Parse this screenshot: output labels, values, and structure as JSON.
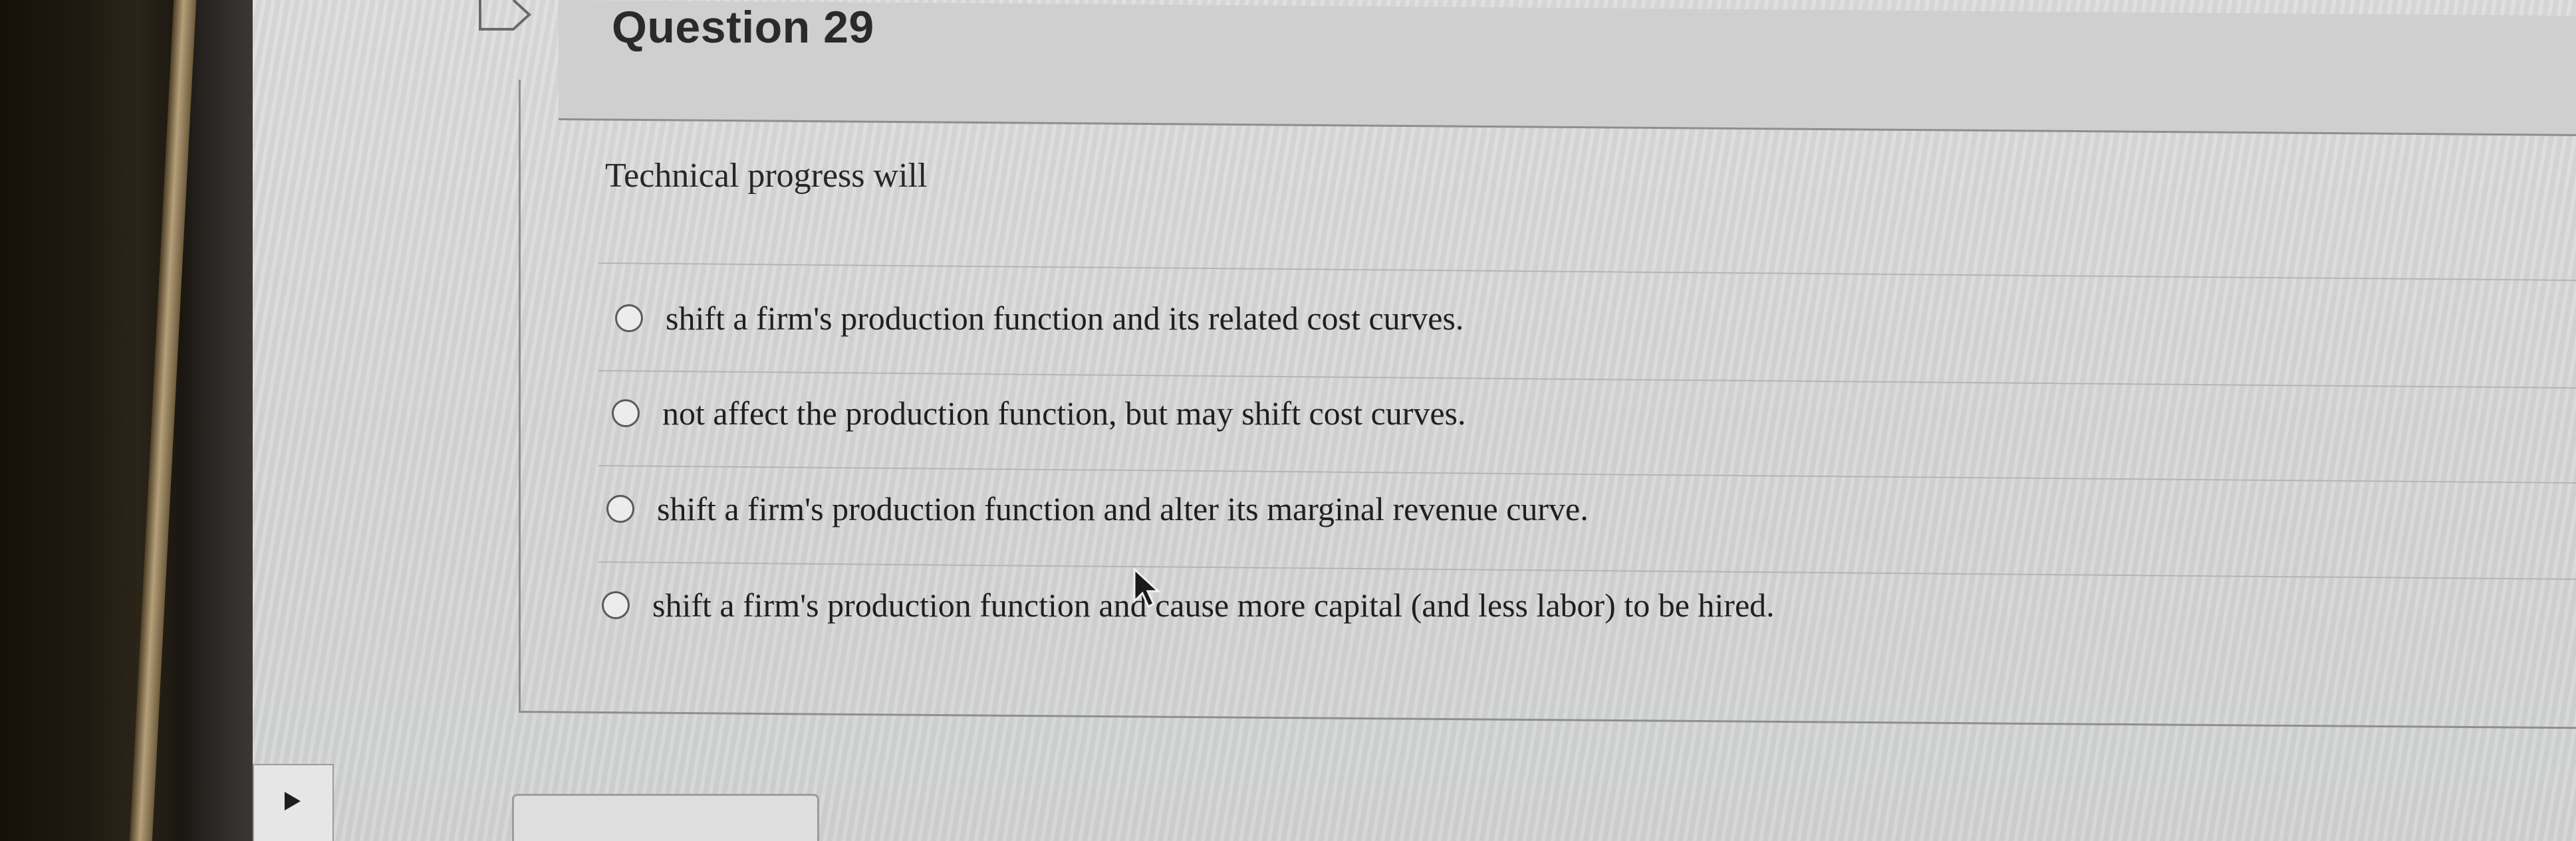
{
  "question": {
    "title": "Question 29",
    "prompt": "Technical progress will",
    "answers": [
      {
        "label": "shift a firm's production function and its related cost curves.",
        "selected": false
      },
      {
        "label": "not affect the production function, but may shift cost curves.",
        "selected": false
      },
      {
        "label": "shift a firm's production function and alter its marginal revenue curve.",
        "selected": false
      },
      {
        "label": "shift a firm's production function and cause more capital (and less labor) to be hired.",
        "selected": false
      }
    ]
  },
  "icons": {
    "flag": "flag-icon",
    "cursor": "mouse-pointer-icon",
    "nav": "triangle-right-icon"
  },
  "colors": {
    "text": "#1f1f1f",
    "border": "#8e8e8e",
    "background": "#d9d9d9"
  }
}
